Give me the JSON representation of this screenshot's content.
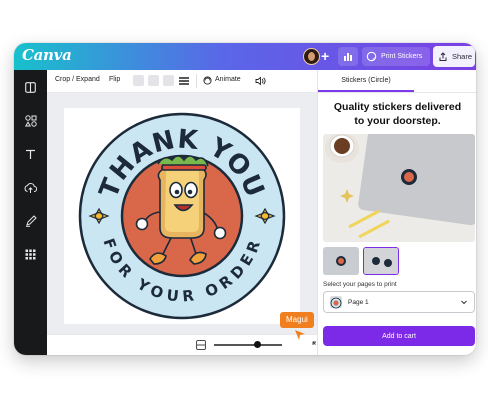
{
  "app": {
    "name": "Canva"
  },
  "topbar": {
    "print_label": "Print Stickers",
    "share_label": "Share"
  },
  "toolbar": {
    "crop_label": "Crop / Expand",
    "flip_label": "Flip",
    "animate_label": "Animate"
  },
  "sidebar": {
    "items": [
      {
        "icon": "layout-icon"
      },
      {
        "icon": "elements-icon"
      },
      {
        "icon": "text-icon"
      },
      {
        "icon": "upload-icon"
      },
      {
        "icon": "draw-icon"
      },
      {
        "icon": "apps-icon"
      }
    ]
  },
  "design": {
    "top_text": "THANK YOU",
    "bottom_text": "FOR YOUR ORDER",
    "colors": {
      "outer_ring": "#c9e6f2",
      "border": "#1c2a3a",
      "inner_fill": "#d9674a",
      "sparkle": "#f6b935"
    }
  },
  "panel": {
    "tab_label": "Stickers (Circle)",
    "heading_line1": "Quality stickers delivered",
    "heading_line2": "to your doorstep.",
    "select_label": "Select your pages to print",
    "selected_page": "Page 1",
    "add_to_cart_label": "Add to cart"
  },
  "collaborator": {
    "name": "Magui",
    "color": "#f0801f"
  },
  "colors": {
    "accent": "#7d2ae8"
  }
}
